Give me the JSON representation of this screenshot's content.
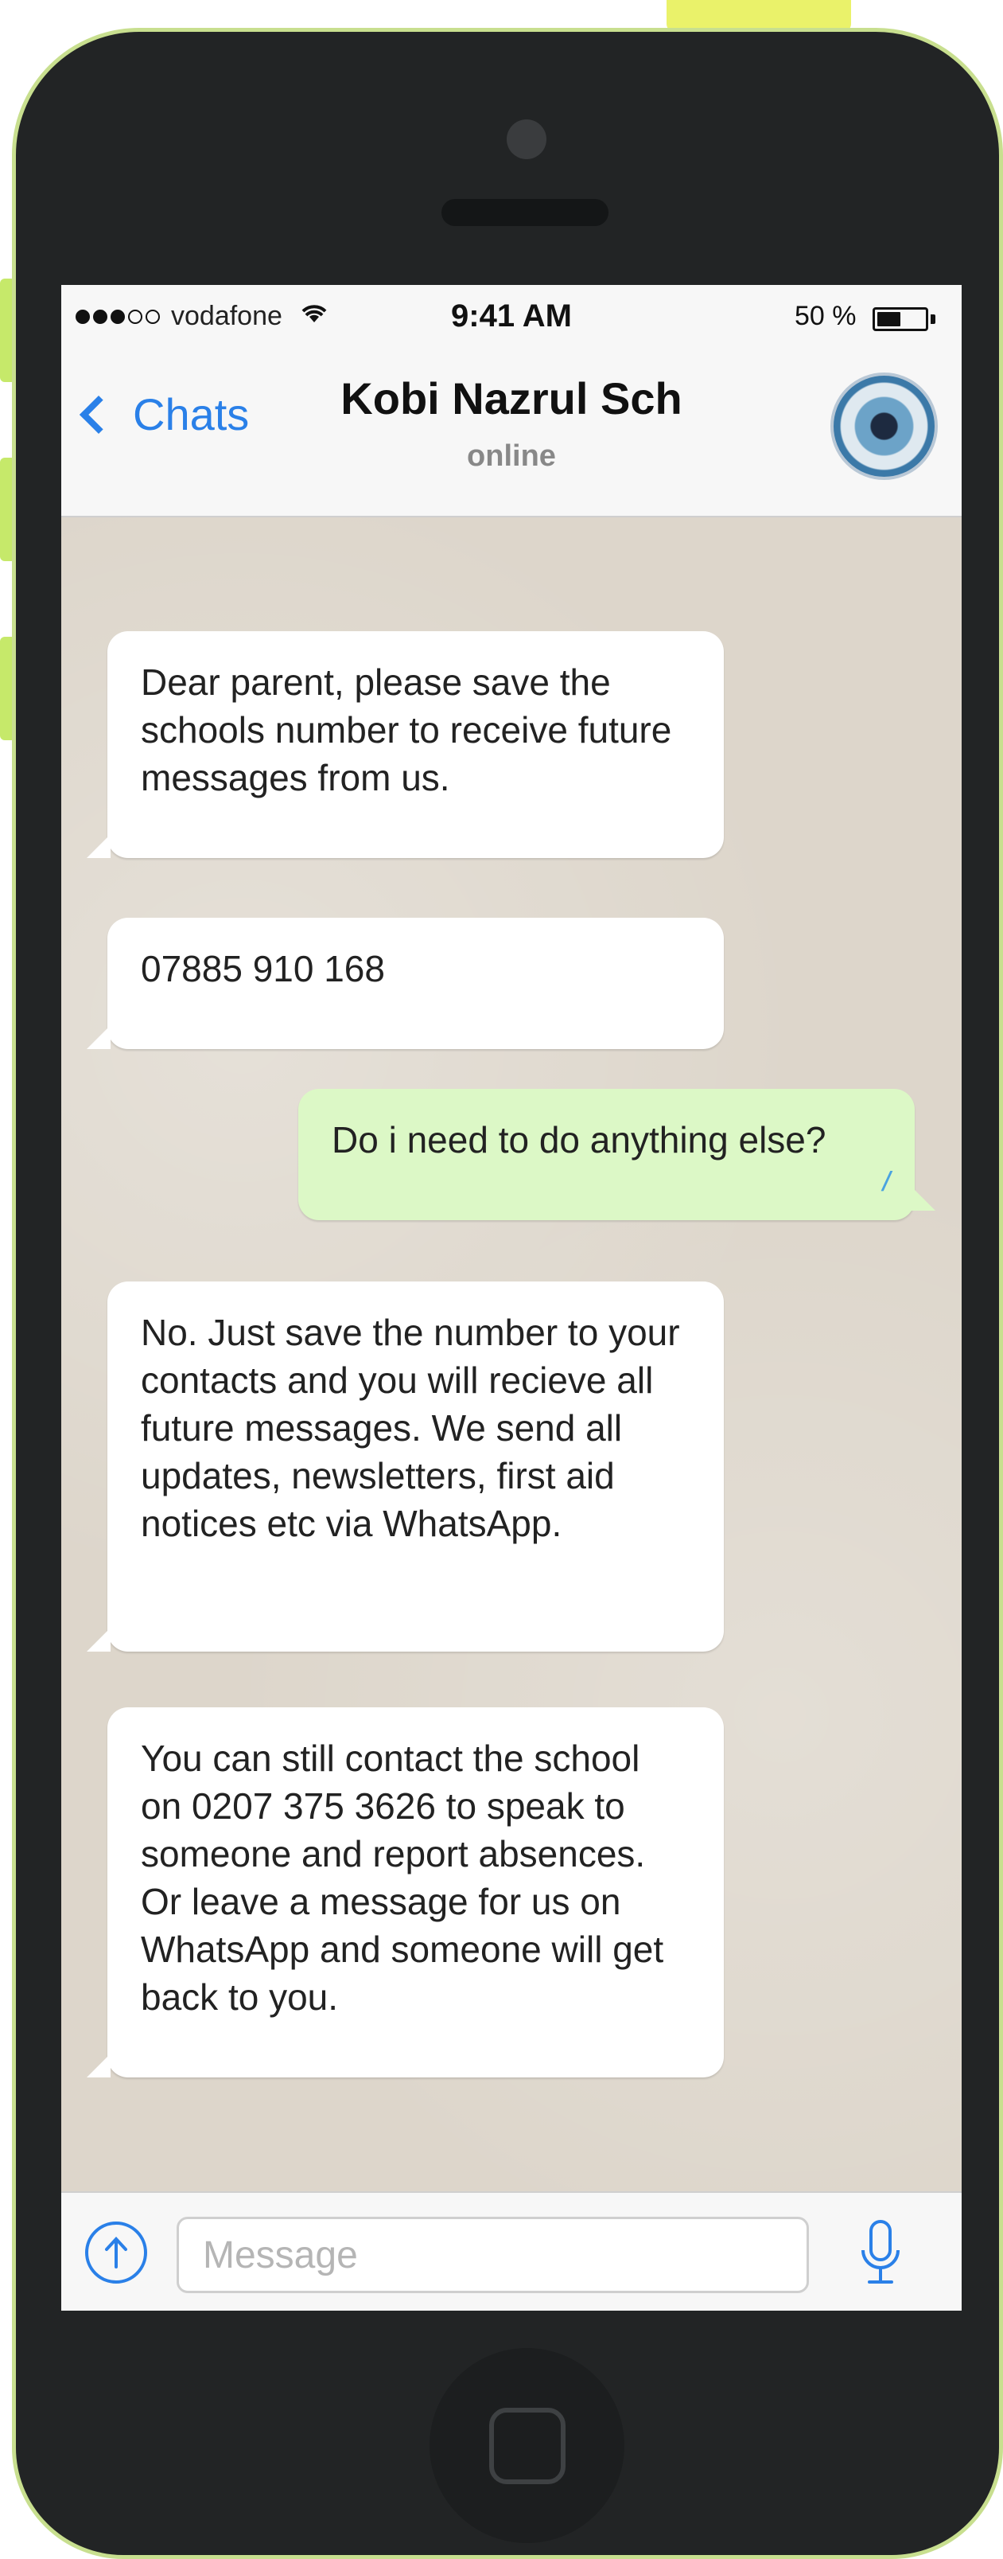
{
  "status_bar": {
    "carrier": "vodafone",
    "time": "9:41 AM",
    "battery": "50 %",
    "battery_level": 0.5
  },
  "header": {
    "back_label": "Chats",
    "contact_name": "Kobi Nazrul Sch",
    "contact_status": "online"
  },
  "messages": [
    {
      "direction": "incoming",
      "text": "Dear parent, please save the schools number to receive future messages from us."
    },
    {
      "direction": "incoming",
      "text": "07885 910 168"
    },
    {
      "direction": "outgoing",
      "text": "Do i need to do anything else?",
      "read": true
    },
    {
      "direction": "incoming",
      "text": "No. Just save the number to your contacts and you will recieve all future messages. We send all updates, newsletters, first aid notices etc via WhatsApp."
    },
    {
      "direction": "incoming",
      "text": "You can still contact the school on 0207 375 3626 to speak to someone and report absences. Or leave a message for us on WhatsApp and someone will get back to you."
    }
  ],
  "composer": {
    "placeholder": "Message"
  },
  "colors": {
    "accent": "#2a80e8",
    "outgoing_bubble": "#dcf8c6",
    "incoming_bubble": "#ffffff",
    "read_ticks": "#4aa3e0",
    "phone_body": "#222425",
    "phone_border": "#c8df8f"
  }
}
